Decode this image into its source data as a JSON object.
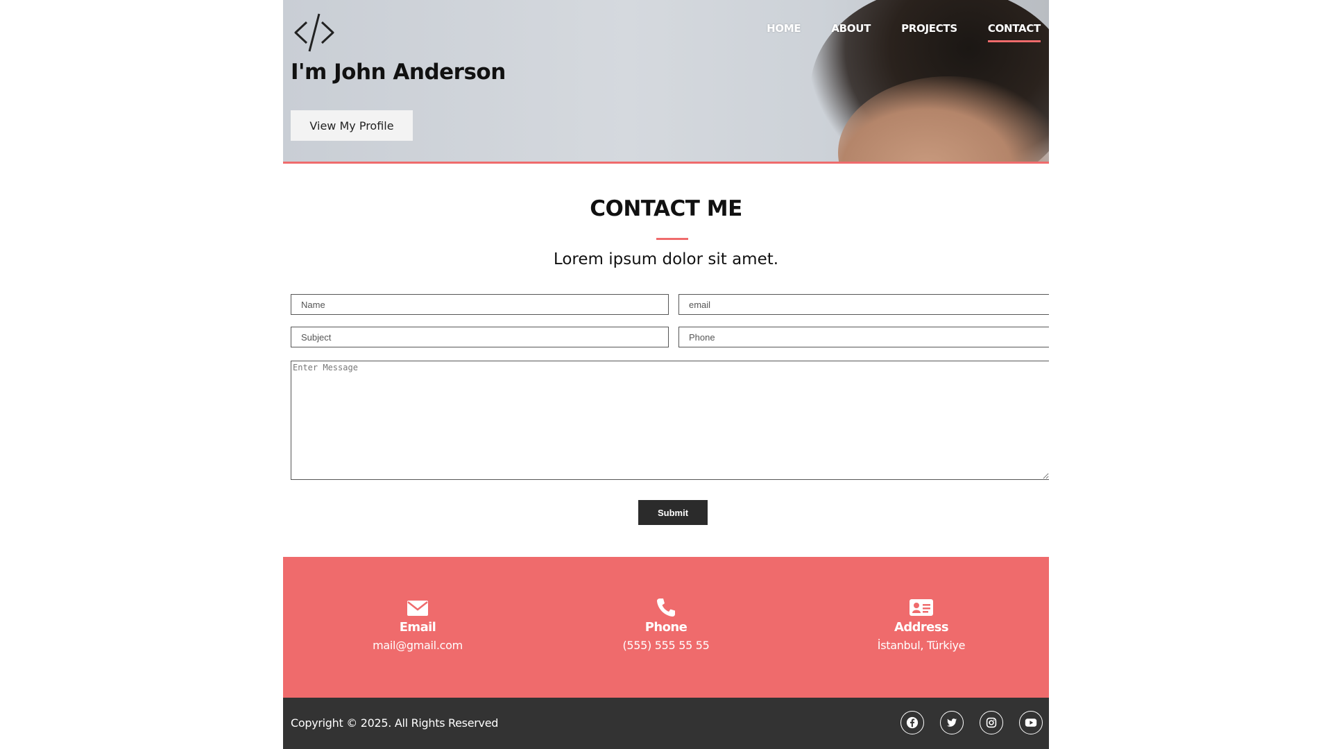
{
  "hero": {
    "logo_icon": "code-brackets-icon",
    "title": "I'm John Anderson",
    "profile_button": "View My Profile"
  },
  "nav": {
    "items": [
      {
        "label": "HOME"
      },
      {
        "label": "ABOUT"
      },
      {
        "label": "PROJECTS"
      },
      {
        "label": "CONTACT",
        "active": true
      }
    ]
  },
  "contact": {
    "title": "CONTACT ME",
    "subtitle": "Lorem ipsum dolor sit amet.",
    "form": {
      "name_placeholder": "Name",
      "email_placeholder": "email",
      "subject_placeholder": "Subject",
      "phone_placeholder": "Phone",
      "message_placeholder": "Enter Message",
      "submit_label": "Submit"
    }
  },
  "info": [
    {
      "icon": "envelope-icon",
      "label": "Email",
      "value": "mail@gmail.com"
    },
    {
      "icon": "phone-icon",
      "label": "Phone",
      "value": "(555) 555 55 55"
    },
    {
      "icon": "address-card-icon",
      "label": "Address",
      "value": "İstanbul, Türkiye"
    }
  ],
  "footer": {
    "copyright": "Copyright © 2025. All Rights Reserved",
    "social_icons": [
      "facebook-icon",
      "twitter-icon",
      "instagram-icon",
      "youtube-icon"
    ]
  },
  "colors": {
    "accent": "#ef6b6c",
    "footer_bg": "#333333",
    "button_dark": "#2b2b2b"
  }
}
